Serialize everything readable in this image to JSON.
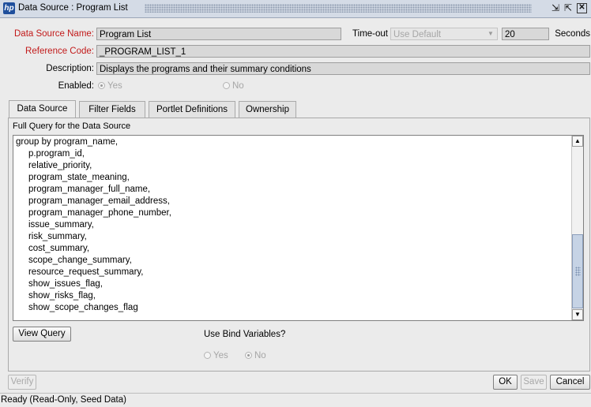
{
  "window": {
    "title": "Data Source : Program List",
    "restore_icon": "restore-icon",
    "maximize_icon": "maximize-icon",
    "close_icon": "close-icon",
    "logo_text": "hp"
  },
  "form": {
    "name_label": "Data Source Name:",
    "name_value": "Program List",
    "timeout_label": "Time-out",
    "timeout_select": "Use Default",
    "timeout_value": "20",
    "timeout_unit": "Seconds",
    "refcode_label": "Reference Code:",
    "refcode_value": "_PROGRAM_LIST_1",
    "desc_label": "Description:",
    "desc_value": "Displays the programs and their summary conditions",
    "enabled_label": "Enabled:",
    "enabled_yes": "Yes",
    "enabled_no": "No",
    "enabled_selected": "Yes"
  },
  "tabs": [
    {
      "label": "Data Source",
      "active": true
    },
    {
      "label": "Filter Fields",
      "active": false
    },
    {
      "label": "Portlet Definitions",
      "active": false
    },
    {
      "label": "Ownership",
      "active": false
    }
  ],
  "query": {
    "label": "Full Query for the Data Source",
    "lines": [
      "group by program_name,",
      "     p.program_id,",
      "     relative_priority,",
      "     program_state_meaning,",
      "     program_manager_full_name,",
      "     program_manager_email_address,",
      "     program_manager_phone_number,",
      "     issue_summary,",
      "     risk_summary,",
      "     cost_summary,",
      "     scope_change_summary,",
      "     resource_request_summary,",
      "     show_issues_flag,",
      "     show_risks_flag,",
      "     show_scope_changes_flag"
    ],
    "view_button": "View Query",
    "bind_label": "Use Bind Variables?",
    "bind_yes": "Yes",
    "bind_no": "No",
    "bind_selected": "No"
  },
  "footer": {
    "verify": "Verify",
    "ok": "OK",
    "save": "Save",
    "cancel": "Cancel"
  },
  "status": "Ready (Read-Only, Seed Data)",
  "colors": {
    "required_label": "#c21a1a",
    "disabled_text": "#a6a6a6",
    "titlebar": "#d4dbe6"
  }
}
